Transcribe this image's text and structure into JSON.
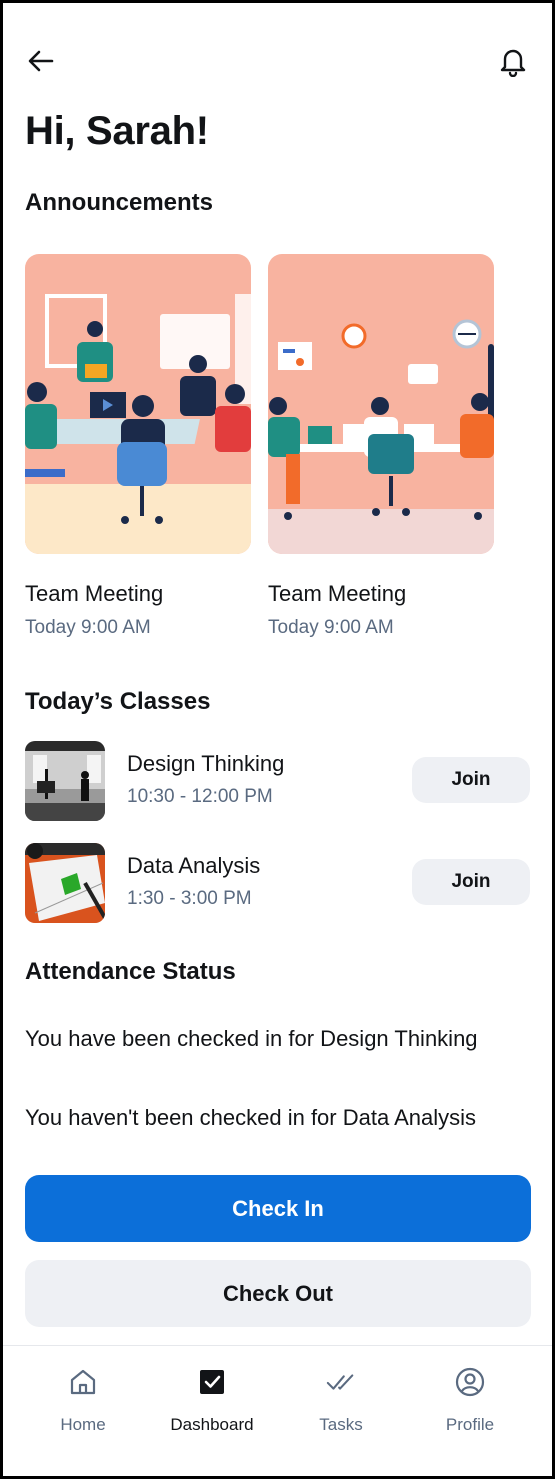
{
  "header": {
    "back_icon": "arrow-left-icon",
    "bell_icon": "bell-icon",
    "greeting": "Hi, Sarah!"
  },
  "announcements": {
    "title": "Announcements",
    "items": [
      {
        "title": "Team Meeting",
        "time": "Today 9:00 AM"
      },
      {
        "title": "Team Meeting",
        "time": "Today 9:00 AM"
      }
    ]
  },
  "classes": {
    "title": "Today’s Classes",
    "items": [
      {
        "name": "Design Thinking",
        "time": "10:30 - 12:00 PM",
        "join_label": "Join"
      },
      {
        "name": "Data Analysis",
        "time": "1:30 - 3:00 PM",
        "join_label": "Join"
      }
    ]
  },
  "attendance": {
    "title": "Attendance Status",
    "lines": [
      "You have been checked in for Design Thinking",
      "You haven't been checked in for Data Analysis"
    ]
  },
  "actions": {
    "check_in": "Check In",
    "check_out": "Check Out"
  },
  "nav": {
    "items": [
      {
        "label": "Home",
        "icon": "home-icon"
      },
      {
        "label": "Dashboard",
        "icon": "checkbox-icon"
      },
      {
        "label": "Tasks",
        "icon": "double-check-icon"
      },
      {
        "label": "Profile",
        "icon": "user-circle-icon"
      }
    ],
    "active": "Dashboard"
  },
  "colors": {
    "primary": "#0c6fd9",
    "secondary_bg": "#eef0f4",
    "muted_text": "#5a6a80",
    "card_bg": "#f8b9a3"
  }
}
